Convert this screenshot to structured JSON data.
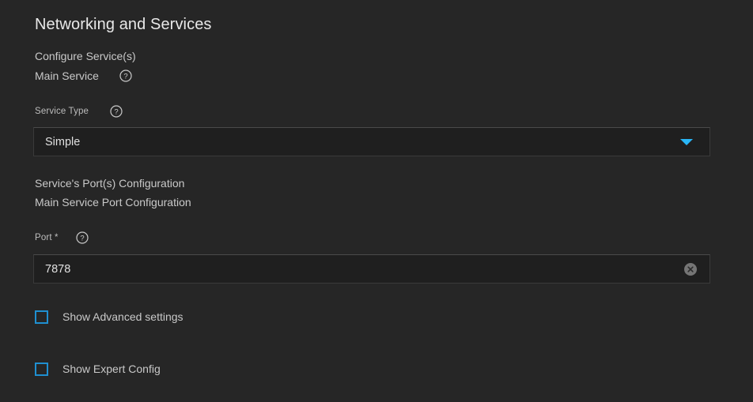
{
  "page": {
    "title": "Networking and Services",
    "background_color": "#262626",
    "accent_color": "#29b6f6",
    "checkbox_border_color": "#1f8fd0"
  },
  "sections": {
    "configure_services": {
      "heading": "Configure Service(s)",
      "subheading": "Main Service",
      "help_icon": "help-circle-icon",
      "service_type": {
        "label": "Service Type",
        "help_icon": "help-circle-icon",
        "value": "Simple",
        "dropdown_icon": "chevron-down-icon"
      }
    },
    "ports_configuration": {
      "heading": "Service's Port(s) Configuration",
      "subheading": "Main Service Port Configuration",
      "port": {
        "label": "Port *",
        "help_icon": "help-circle-icon",
        "value": "7878",
        "clear_icon": "clear-circle-icon"
      }
    }
  },
  "toggles": [
    {
      "label": "Show Advanced settings",
      "checked": false
    },
    {
      "label": "Show Expert Config",
      "checked": false
    }
  ]
}
